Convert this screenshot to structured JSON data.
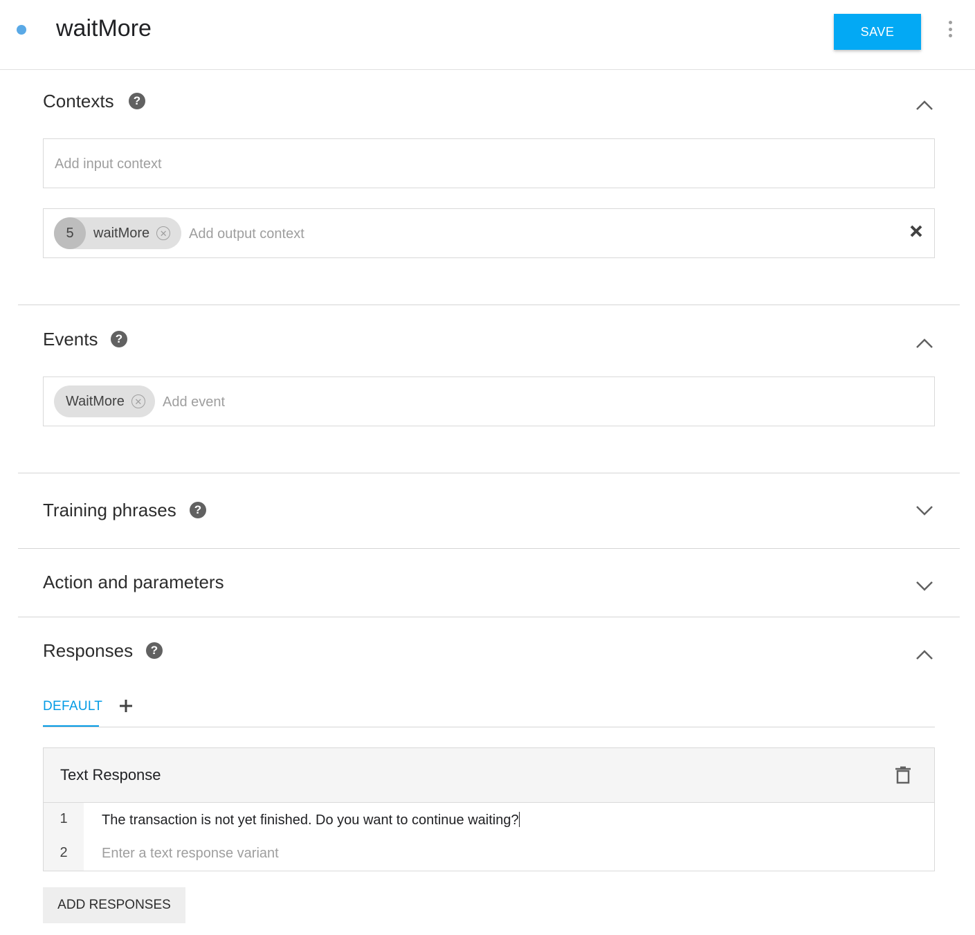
{
  "header": {
    "intent_name": "waitMore",
    "save_label": "SAVE"
  },
  "contexts": {
    "title": "Contexts",
    "input_placeholder": "Add input context",
    "output_chips": [
      {
        "lifespan": "5",
        "name": "waitMore"
      }
    ],
    "output_placeholder": "Add output context"
  },
  "events": {
    "title": "Events",
    "chips": [
      {
        "name": "WaitMore"
      }
    ],
    "placeholder": "Add event"
  },
  "training_phrases": {
    "title": "Training phrases"
  },
  "action_parameters": {
    "title": "Action and parameters"
  },
  "responses": {
    "title": "Responses",
    "tabs": [
      {
        "label": "DEFAULT"
      }
    ],
    "card_title": "Text Response",
    "rows": [
      {
        "num": "1",
        "text": "The transaction is not yet finished. Do you want to continue waiting?"
      },
      {
        "num": "2",
        "placeholder": "Enter a text response variant"
      }
    ],
    "add_responses_label": "ADD RESPONSES"
  },
  "colors": {
    "accent": "#03a9f4",
    "status_dot": "#5aa9e6",
    "tab_active": "#039be5"
  }
}
